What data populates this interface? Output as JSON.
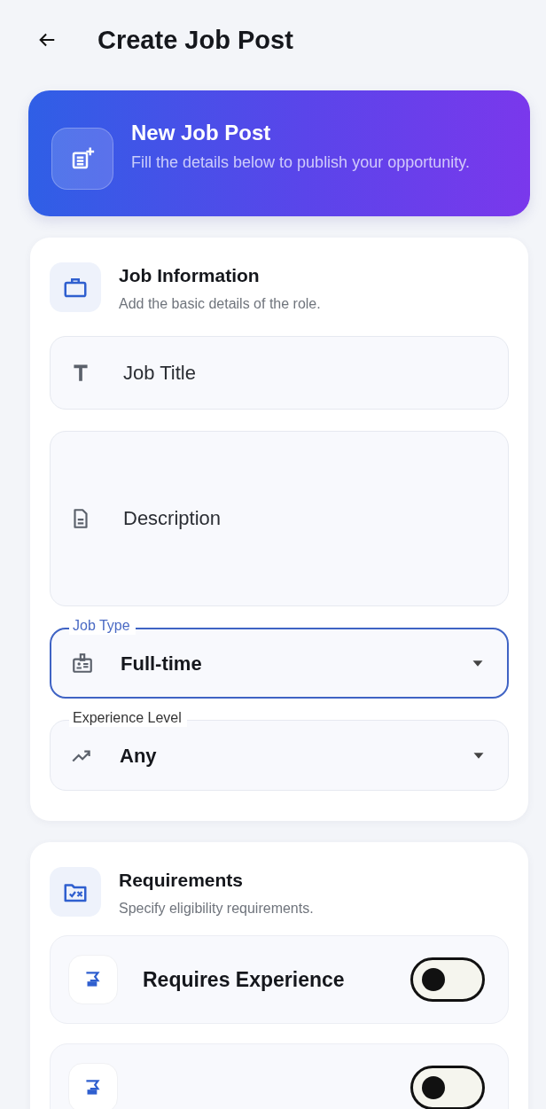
{
  "header": {
    "title": "Create Job Post"
  },
  "banner": {
    "title": "New Job Post",
    "subtitle": "Fill the details below to publish your opportunity."
  },
  "job_information": {
    "title": "Job Information",
    "subtitle": "Add the basic details of the role.",
    "fields": [
      {
        "kind": "text",
        "placeholder": "Job Title"
      },
      {
        "kind": "textarea",
        "placeholder": "Description"
      },
      {
        "kind": "select",
        "label": "Job Type",
        "value": "Full-time",
        "focused": true
      },
      {
        "kind": "select",
        "label": "Experience Level",
        "value": "Any",
        "focused": false
      }
    ]
  },
  "requirements": {
    "title": "Requirements",
    "subtitle": "Specify eligibility requirements.",
    "items": [
      {
        "label": "Requires Experience",
        "on": false
      },
      {
        "on": false
      }
    ]
  }
}
